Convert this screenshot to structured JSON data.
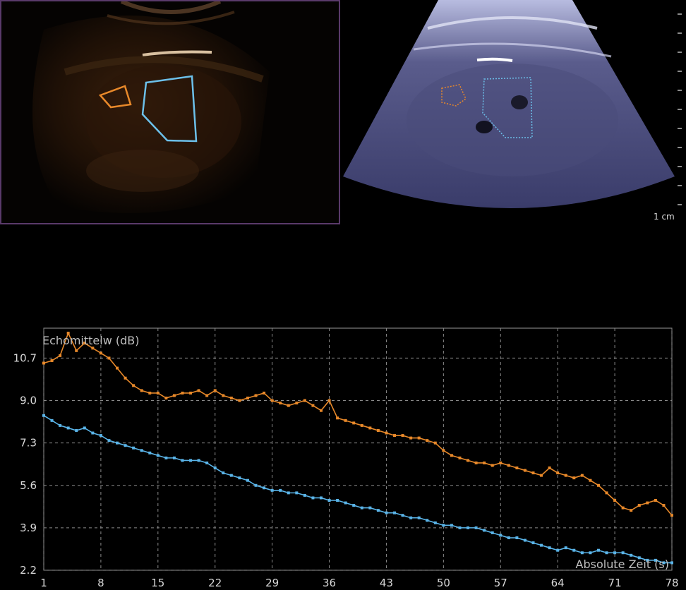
{
  "images": {
    "scale_label": "1 cm"
  },
  "chart_data": {
    "type": "line",
    "ylabel": "Echomittelw (dB)",
    "xlabel": "Absolute Zeit (s)",
    "x_ticks": [
      "1",
      "8",
      "15",
      "22",
      "29",
      "36",
      "43",
      "50",
      "57",
      "64",
      "71",
      "78"
    ],
    "y_ticks": [
      "10.7",
      "9.0",
      "7.3",
      "5.6",
      "3.9",
      "2.2"
    ],
    "xlim": [
      1,
      78
    ],
    "ylim": [
      2.2,
      11.9
    ],
    "grid": true,
    "colors": {
      "orange": "#e8892a",
      "blue": "#5ab4e8",
      "grid": "#8a8a8a",
      "roi_orange": "#e8892a",
      "roi_blue": "#6cc0ea"
    },
    "series": [
      {
        "color": "orange",
        "x": [
          1,
          2,
          3,
          4,
          5,
          6,
          7,
          8,
          9,
          10,
          11,
          12,
          13,
          14,
          15,
          16,
          17,
          18,
          19,
          20,
          21,
          22,
          23,
          24,
          25,
          26,
          27,
          28,
          29,
          30,
          31,
          32,
          33,
          34,
          35,
          36,
          37,
          38,
          39,
          40,
          41,
          42,
          43,
          44,
          45,
          46,
          47,
          48,
          49,
          50,
          51,
          52,
          53,
          54,
          55,
          56,
          57,
          58,
          59,
          60,
          61,
          62,
          63,
          64,
          65,
          66,
          67,
          68,
          69,
          70,
          71,
          72,
          73,
          74,
          75,
          76,
          77,
          78
        ],
        "values": [
          10.5,
          10.6,
          10.8,
          11.7,
          11.0,
          11.3,
          11.1,
          10.9,
          10.7,
          10.3,
          9.9,
          9.6,
          9.4,
          9.3,
          9.3,
          9.1,
          9.2,
          9.3,
          9.3,
          9.4,
          9.2,
          9.4,
          9.2,
          9.1,
          9.0,
          9.1,
          9.2,
          9.3,
          9.0,
          8.9,
          8.8,
          8.9,
          9.0,
          8.8,
          8.6,
          9.0,
          8.3,
          8.2,
          8.1,
          8.0,
          7.9,
          7.8,
          7.7,
          7.6,
          7.6,
          7.5,
          7.5,
          7.4,
          7.3,
          7.0,
          6.8,
          6.7,
          6.6,
          6.5,
          6.5,
          6.4,
          6.5,
          6.4,
          6.3,
          6.2,
          6.1,
          6.0,
          6.3,
          6.1,
          6.0,
          5.9,
          6.0,
          5.8,
          5.6,
          5.3,
          5.0,
          4.7,
          4.6,
          4.8,
          4.9,
          5.0,
          4.8,
          4.4
        ]
      },
      {
        "color": "blue",
        "x": [
          1,
          2,
          3,
          4,
          5,
          6,
          7,
          8,
          9,
          10,
          11,
          12,
          13,
          14,
          15,
          16,
          17,
          18,
          19,
          20,
          21,
          22,
          23,
          24,
          25,
          26,
          27,
          28,
          29,
          30,
          31,
          32,
          33,
          34,
          35,
          36,
          37,
          38,
          39,
          40,
          41,
          42,
          43,
          44,
          45,
          46,
          47,
          48,
          49,
          50,
          51,
          52,
          53,
          54,
          55,
          56,
          57,
          58,
          59,
          60,
          61,
          62,
          63,
          64,
          65,
          66,
          67,
          68,
          69,
          70,
          71,
          72,
          73,
          74,
          75,
          76,
          77,
          78
        ],
        "values": [
          8.4,
          8.2,
          8.0,
          7.9,
          7.8,
          7.9,
          7.7,
          7.6,
          7.4,
          7.3,
          7.2,
          7.1,
          7.0,
          6.9,
          6.8,
          6.7,
          6.7,
          6.6,
          6.6,
          6.6,
          6.5,
          6.3,
          6.1,
          6.0,
          5.9,
          5.8,
          5.6,
          5.5,
          5.4,
          5.4,
          5.3,
          5.3,
          5.2,
          5.1,
          5.1,
          5.0,
          5.0,
          4.9,
          4.8,
          4.7,
          4.7,
          4.6,
          4.5,
          4.5,
          4.4,
          4.3,
          4.3,
          4.2,
          4.1,
          4.0,
          4.0,
          3.9,
          3.9,
          3.9,
          3.8,
          3.7,
          3.6,
          3.5,
          3.5,
          3.4,
          3.3,
          3.2,
          3.1,
          3.0,
          3.1,
          3.0,
          2.9,
          2.9,
          3.0,
          2.9,
          2.9,
          2.9,
          2.8,
          2.7,
          2.6,
          2.6,
          2.5,
          2.5
        ]
      }
    ]
  }
}
